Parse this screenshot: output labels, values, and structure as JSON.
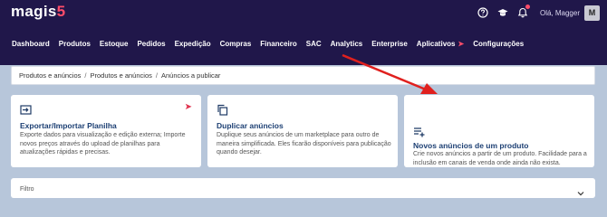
{
  "header": {
    "logo_text": "magis",
    "logo_suffix": "5",
    "greeting": "Olá, Magger",
    "avatar_initial": "M",
    "icons": [
      "help-icon",
      "graduation-cap-icon",
      "bell-icon"
    ]
  },
  "nav": {
    "items": [
      {
        "label": "Dashboard"
      },
      {
        "label": "Produtos"
      },
      {
        "label": "Estoque"
      },
      {
        "label": "Pedidos"
      },
      {
        "label": "Expedição"
      },
      {
        "label": "Compras"
      },
      {
        "label": "Financeiro"
      },
      {
        "label": "SAC"
      },
      {
        "label": "Analytics"
      },
      {
        "label": "Enterprise"
      },
      {
        "label": "Aplicativos"
      },
      {
        "label": "Configurações"
      }
    ]
  },
  "breadcrumb": {
    "items": [
      "Produtos e anúncios",
      "Produtos e anúncios",
      "Anúncios a publicar"
    ],
    "separator": "/"
  },
  "cards": [
    {
      "title": "Exportar/Importar Planilha",
      "description": "Exporte dados para visualização e edição externa; Importe novos preços através do upload de planilhas para atualizações rápidas e precisas.",
      "icon": "export-icon"
    },
    {
      "title": "Duplicar anúncios",
      "description": "Duplique seus anúncios de um marketplace para outro de maneira simplificada. Eles ficarão disponíveis para publicação quando desejar.",
      "icon": "copy-icon"
    },
    {
      "title": "Novos anúncios de um produto",
      "description": "Crie novos anúncios a partir de um produto. Facilidade para a inclusão em canais de venda onde ainda não exista.",
      "icon": "playlist-add-icon"
    }
  ],
  "filter": {
    "label": "Filtro"
  },
  "colors": {
    "header_bg": "#20174a",
    "page_bg": "#b7c6da",
    "accent": "#ff4d6a",
    "arrow": "#e0201e",
    "card_title": "#1c3f73"
  }
}
